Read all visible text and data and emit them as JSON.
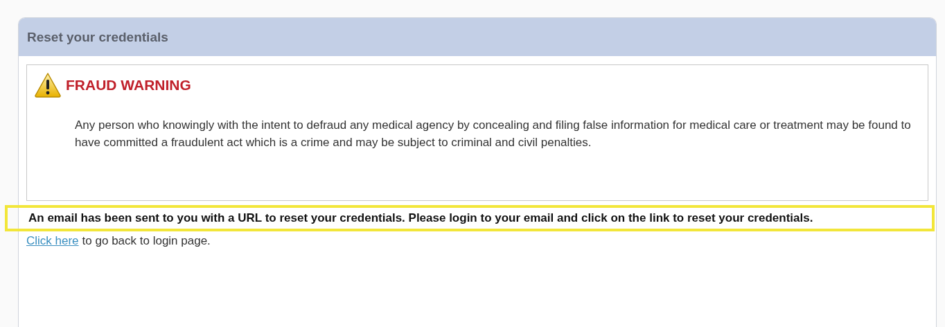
{
  "panel": {
    "title": "Reset your credentials"
  },
  "warning": {
    "title": "FRAUD WARNING",
    "body": "Any person who knowingly with the intent to defraud any medical agency by concealing and filing false information for medical care or treatment may be found to have committed a fraudulent act which is a crime and may be subject to criminal and civil penalties."
  },
  "notice": {
    "text": "An email has been sent to you with a URL to reset your credentials. Please login to your email and click on the link to reset your credentials.",
    "highlighted": true
  },
  "back": {
    "link": "Click here",
    "text": "to go back to login page."
  }
}
